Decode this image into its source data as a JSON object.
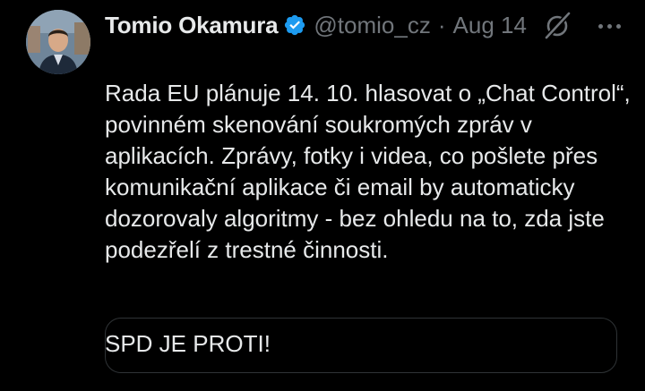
{
  "author": {
    "name": "Tomio Okamura",
    "handle": "@tomio_cz",
    "separator": "·",
    "date": "Aug 14"
  },
  "tweet": {
    "paragraph1": "Rada EU plánuje 14. 10. hlasovat o „Chat Control“, povinném skenování soukromých zpráv v aplikacích. Zprávy, fotky i videa, co pošlete přes komunikační aplikace či email by automaticky dozorovaly algoritmy - bez ohledu na to, zda jste podezřelí z trestné činnosti.",
    "paragraph2": "SPD JE PROTI!"
  },
  "icons": {
    "verified": "verified-badge-icon",
    "grok": "grok-icon",
    "more": "more-icon"
  },
  "colors": {
    "background": "#000000",
    "text": "#e7e9ea",
    "muted": "#71767b",
    "verified": "#1d9bf0"
  }
}
